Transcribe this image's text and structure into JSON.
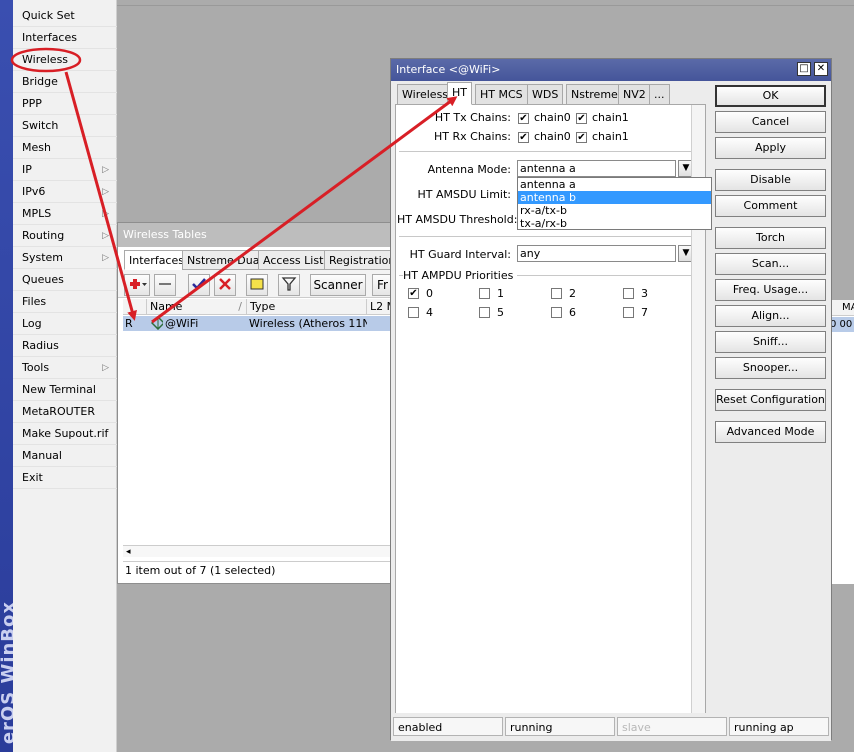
{
  "brand": {
    "text": "erOS WinBox"
  },
  "menu": {
    "items": [
      {
        "label": "Quick Set",
        "arrow": ""
      },
      {
        "label": "Interfaces",
        "arrow": ""
      },
      {
        "label": "Wireless",
        "arrow": ""
      },
      {
        "label": "Bridge",
        "arrow": ""
      },
      {
        "label": "PPP",
        "arrow": ""
      },
      {
        "label": "Switch",
        "arrow": ""
      },
      {
        "label": "Mesh",
        "arrow": ""
      },
      {
        "label": "IP",
        "arrow": "▷"
      },
      {
        "label": "IPv6",
        "arrow": "▷"
      },
      {
        "label": "MPLS",
        "arrow": "▷"
      },
      {
        "label": "Routing",
        "arrow": "▷"
      },
      {
        "label": "System",
        "arrow": "▷"
      },
      {
        "label": "Queues",
        "arrow": ""
      },
      {
        "label": "Files",
        "arrow": ""
      },
      {
        "label": "Log",
        "arrow": ""
      },
      {
        "label": "Radius",
        "arrow": ""
      },
      {
        "label": "Tools",
        "arrow": "▷"
      },
      {
        "label": "New Terminal",
        "arrow": ""
      },
      {
        "label": "MetaROUTER",
        "arrow": ""
      },
      {
        "label": "Make Supout.rif",
        "arrow": ""
      },
      {
        "label": "Manual",
        "arrow": ""
      },
      {
        "label": "Exit",
        "arrow": ""
      }
    ]
  },
  "wireless_tables": {
    "title": "Wireless Tables",
    "tabs": [
      "Interfaces",
      "Nstreme Dual",
      "Access List",
      "Registration"
    ],
    "toolbar": {
      "scanner": "Scanner",
      "next": "Fr"
    },
    "columns": [
      "Name",
      "Type",
      "L2 M"
    ],
    "sort_marker": "/",
    "row": {
      "flag": "R",
      "name": "@WiFi",
      "type": "Wireless (Atheros 11N)",
      "l2": ""
    },
    "scroll_left": "◂",
    "status": "1 item out of 7 (1 selected)"
  },
  "right_window": {
    "col_header": "MA",
    "cell": "0 00"
  },
  "dialog": {
    "title": "Interface <@WiFi>",
    "tabs": [
      "Wireless",
      "HT",
      "HT MCS",
      "WDS",
      "Nstreme",
      "NV2",
      "..."
    ],
    "ht_tx_label": "HT Tx Chains:",
    "ht_rx_label": "HT Rx Chains:",
    "chain0": "chain0",
    "chain1": "chain1",
    "antenna_label": "Antenna Mode:",
    "antenna_value": "antenna a",
    "antenna_options": [
      "antenna a",
      "antenna b",
      "rx-a/tx-b",
      "tx-a/rx-b"
    ],
    "amsdu_limit_label": "HT AMSDU Limit:",
    "amsdu_threshold_label": "HT AMSDU Threshold:",
    "guard_label": "HT Guard Interval:",
    "guard_value": "any",
    "ampdu_label": "HT AMPDU Priorities",
    "priorities": [
      {
        "v": "0",
        "checked": true
      },
      {
        "v": "1",
        "checked": false
      },
      {
        "v": "2",
        "checked": false
      },
      {
        "v": "3",
        "checked": false
      },
      {
        "v": "4",
        "checked": false
      },
      {
        "v": "5",
        "checked": false
      },
      {
        "v": "6",
        "checked": false
      },
      {
        "v": "7",
        "checked": false
      }
    ],
    "buttons": [
      "OK",
      "Cancel",
      "Apply",
      "Disable",
      "Comment",
      "Torch",
      "Scan...",
      "Freq. Usage...",
      "Align...",
      "Sniff...",
      "Snooper...",
      "Reset Configuration",
      "Advanced Mode"
    ],
    "status": [
      "enabled",
      "running",
      "slave",
      "running ap"
    ],
    "check_glyph": "✔",
    "dropdown_glyph": "▼",
    "maximize_glyph": "□",
    "close_glyph": "✕"
  },
  "colors": {
    "annotation_red": "#d81f26",
    "dialog_title": "#4e5ea0",
    "selection_blue": "#3399ff",
    "row_highlight": "#b8cbe8"
  },
  "icons": {
    "add": "plus-icon",
    "remove": "minus-icon",
    "enable": "check-icon",
    "disable": "x-icon",
    "comment": "note-icon",
    "filter": "filter-icon",
    "wifi": "wireless-interface-icon"
  }
}
